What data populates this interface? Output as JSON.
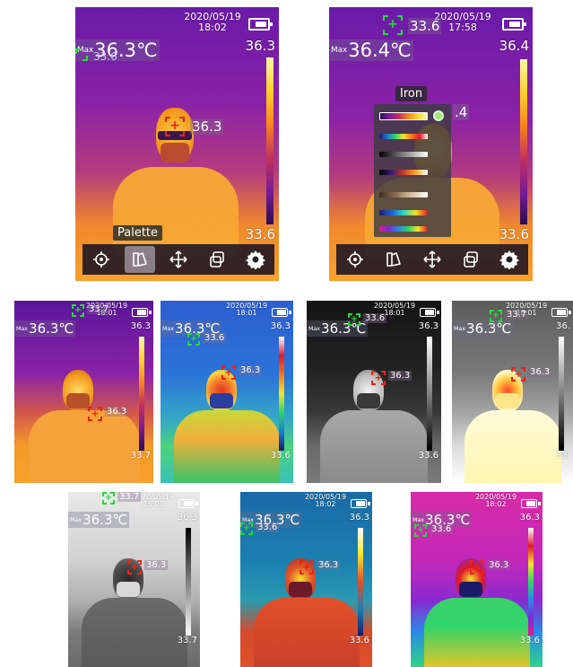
{
  "screens": [
    {
      "id": "s1",
      "date": "2020/05/19",
      "time": "18:02",
      "max_value": "36.3℃",
      "max_prefix": "Max",
      "scale_top": "36.3",
      "scale_bottom": "33.6",
      "center_reading": "36.3",
      "cursor_reading": "33.6",
      "palette": "iron",
      "tooltip": "Palette"
    },
    {
      "id": "s2",
      "date": "2020/05/19",
      "time": "17:58",
      "max_value": "36.4℃",
      "max_prefix": "Max",
      "scale_top": "36.4",
      "scale_bottom": "33.6",
      "center_reading": ".4",
      "cursor_reading": "33.6",
      "palette": "iron",
      "menu_title": "Iron"
    },
    {
      "id": "s3",
      "date": "2020/05/19",
      "time": "18:01",
      "max_value": "36.3℃",
      "max_prefix": "Max",
      "scale_top": "36.3",
      "scale_bottom": "33.7",
      "center_reading": "36.3",
      "cursor_reading": "33.7",
      "palette": "iron"
    },
    {
      "id": "s4",
      "date": "2020/05/19",
      "time": "18:01",
      "max_value": "36.3℃",
      "max_prefix": "Max",
      "scale_top": "36.3",
      "scale_bottom": "33.6",
      "center_reading": "36.3",
      "cursor_reading": "33.6",
      "palette": "rainbow"
    },
    {
      "id": "s5",
      "date": "2020/05/19",
      "time": "18:01",
      "max_value": "36.3℃",
      "max_prefix": "Max",
      "scale_top": "36.3",
      "scale_bottom": "33.6",
      "center_reading": "36.3",
      "cursor_reading": "33.6",
      "palette": "whitehot"
    },
    {
      "id": "s6",
      "date": "2020/05/19",
      "time": "18:01",
      "max_value": "36.3℃",
      "max_prefix": "Max",
      "scale_top": "36.",
      "scale_bottom": "33.",
      "center_reading": "36.3",
      "cursor_reading": "33.7",
      "palette": "whitehot_bright"
    },
    {
      "id": "s7",
      "date": "2020/05/19",
      "time": "18:01",
      "max_value": "36.3℃",
      "max_prefix": "Max",
      "scale_top": "36.3",
      "scale_bottom": "33.7",
      "center_reading": "36.3",
      "cursor_reading": "33.7",
      "palette": "blackhot"
    },
    {
      "id": "s8",
      "date": "2020/05/19",
      "time": "18:02",
      "max_value": "36.3℃",
      "max_prefix": "Max",
      "scale_top": "36.3",
      "scale_bottom": "33.6",
      "center_reading": "36.3",
      "cursor_reading": "33.6",
      "palette": "rainbow_hc"
    },
    {
      "id": "s9",
      "date": "2020/05/19",
      "time": "18:02",
      "max_value": "36.3℃",
      "max_prefix": "Max",
      "scale_top": "36.3",
      "scale_bottom": "33.6",
      "center_reading": "36.3",
      "cursor_reading": "33.6",
      "palette": "magenta"
    }
  ],
  "toolbar_icons": [
    "target-icon",
    "palette-icon",
    "move-icon",
    "layers-icon",
    "gear-icon"
  ],
  "palette_menu": {
    "options": [
      "iron",
      "rainbow",
      "whitehot",
      "lava",
      "sepia",
      "rainbow_hc",
      "blackhot"
    ],
    "selected": "iron"
  },
  "colors": {
    "cursor_green": "#22dd33",
    "cursor_red": "#ee2211"
  }
}
